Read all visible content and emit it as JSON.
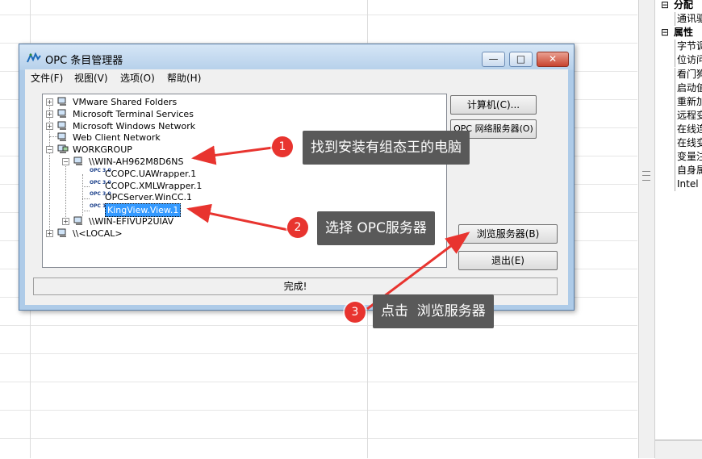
{
  "window": {
    "title": "OPC 条目管理器",
    "min_glyph": "—",
    "max_glyph": "□",
    "close_glyph": "✕"
  },
  "menu": [
    "文件(F)",
    "视图(V)",
    "选项(O)",
    "帮助(H)"
  ],
  "tree": {
    "nodes": [
      {
        "label": "VMware Shared Folders",
        "icon": "network-computer-icon",
        "expander": "+"
      },
      {
        "label": "Microsoft Terminal Services",
        "icon": "network-computer-icon",
        "expander": "+"
      },
      {
        "label": "Microsoft Windows Network",
        "icon": "network-computer-icon",
        "expander": "+"
      },
      {
        "label": "Web Client Network",
        "icon": "network-computer-icon",
        "expander": ""
      },
      {
        "label": "WORKGROUP",
        "icon": "workgroup-icon",
        "expander": "−"
      },
      {
        "label": "\\\\WIN-AH962M8D6NS",
        "icon": "computer-icon",
        "expander": "−"
      },
      {
        "label": "CCOPC.UAWrapper.1",
        "icon": "opc-server-icon",
        "icon_text": "OPC 3.0"
      },
      {
        "label": "CCOPC.XMLWrapper.1",
        "icon": "opc-server-icon",
        "icon_text": "OPC 3.0"
      },
      {
        "label": "OPCServer.WinCC.1",
        "icon": "opc-server-icon",
        "icon_text": "OPC 3.0"
      },
      {
        "label": "KingView.View.1",
        "icon": "opc-server-icon",
        "icon_text": "OPC 1/2",
        "selected": true
      },
      {
        "label": "\\\\WIN-EFIVUP2UIAV",
        "icon": "computer-icon",
        "expander": "+"
      },
      {
        "label": "\\\\<LOCAL>",
        "icon": "local-computer-icon",
        "expander": "+"
      }
    ]
  },
  "buttons": {
    "computer": "计算机(C)...",
    "opc_network": "OPC 网络服务器(O)",
    "browse": "浏览服务器(B)",
    "exit": "退出(E)"
  },
  "status": "完成!",
  "annotations": [
    {
      "number": "1",
      "text": "找到安装有组态王的电脑"
    },
    {
      "number": "2",
      "text": "选择 OPC服务器"
    },
    {
      "number": "3",
      "text": "点击  浏览服务器"
    }
  ],
  "right_panel": {
    "rows": [
      {
        "type": "group",
        "label": "分配",
        "expander": "⊟"
      },
      {
        "type": "item",
        "label": "通讯驱"
      },
      {
        "type": "group",
        "label": "属性",
        "expander": "⊟"
      },
      {
        "type": "item",
        "label": "字节调"
      },
      {
        "type": "item",
        "label": "位访问"
      },
      {
        "type": "item",
        "label": "看门狗"
      },
      {
        "type": "item",
        "label": "启动值"
      },
      {
        "type": "item",
        "label": "重新加"
      },
      {
        "type": "item",
        "label": "远程变"
      },
      {
        "type": "item",
        "label": "在线连"
      },
      {
        "type": "item",
        "label": "在线变"
      },
      {
        "type": "item",
        "label": "变量注"
      },
      {
        "type": "item",
        "label": "自身属"
      },
      {
        "type": "item",
        "label": "Intel 字"
      }
    ]
  },
  "colors": {
    "callout_bg": "#595959",
    "badge": "#e8342f",
    "arrow": "#e8342f",
    "selection": "#3399ff",
    "window_frame": "#aecbe8"
  }
}
